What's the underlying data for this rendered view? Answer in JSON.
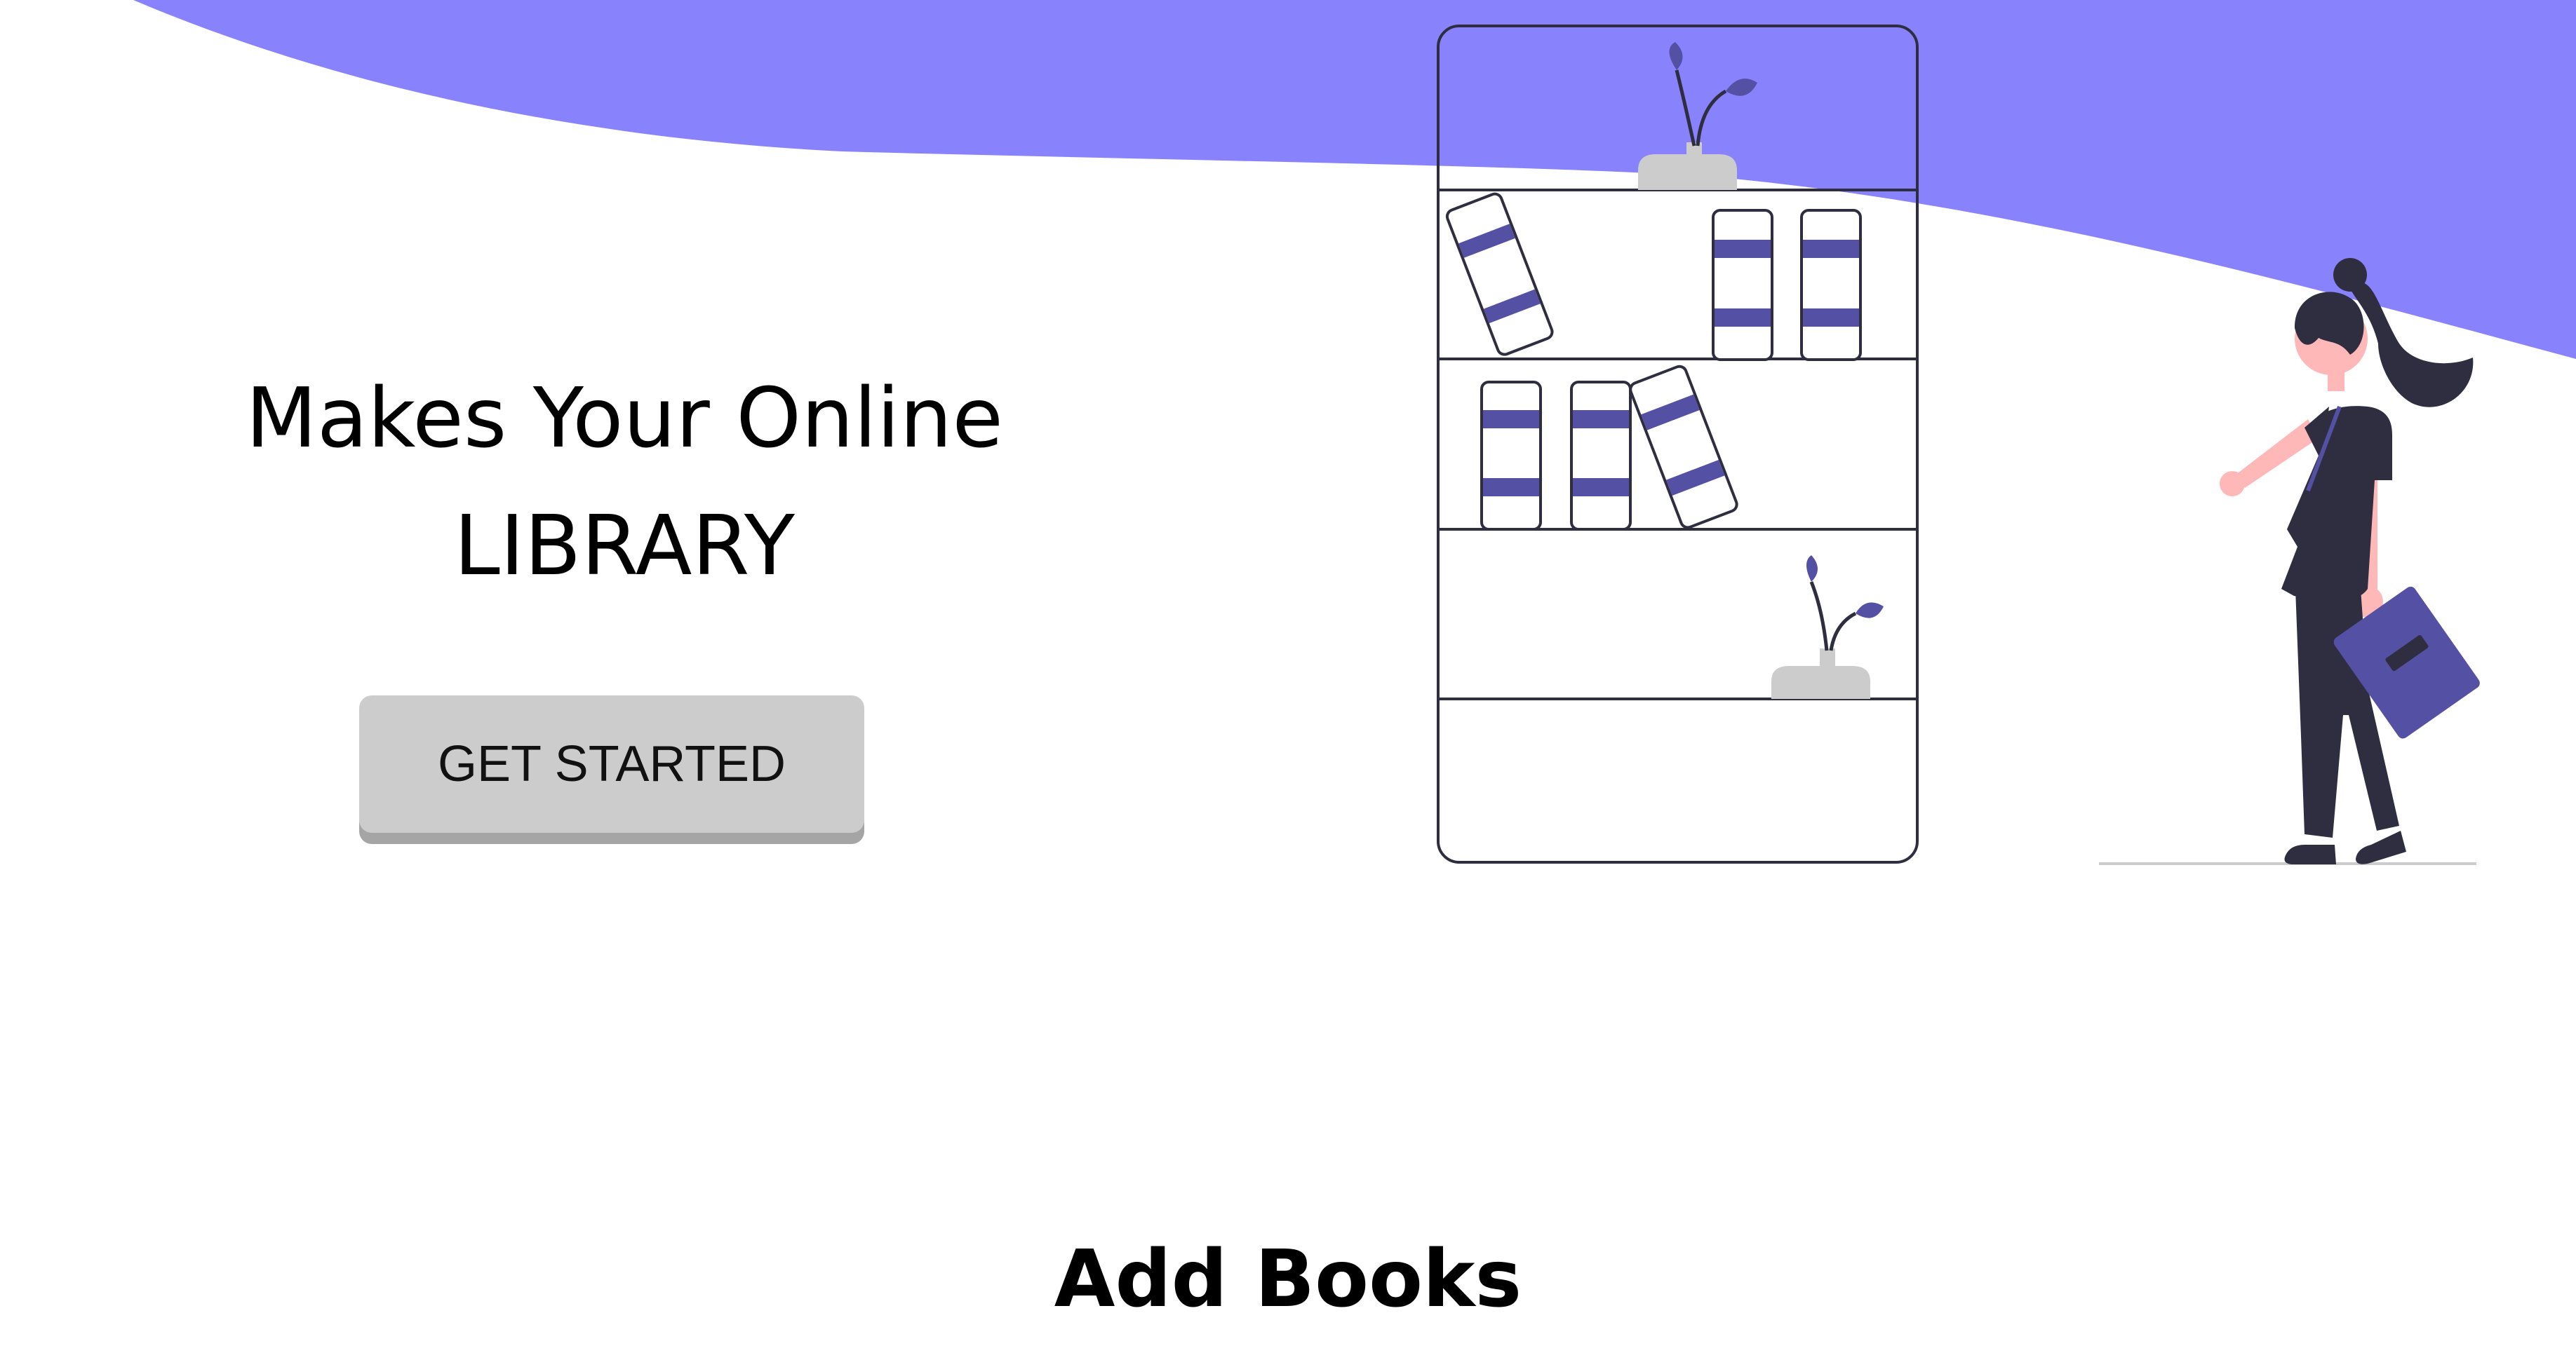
{
  "hero": {
    "title_line1": "Makes Your Online",
    "title_line2": "LIBRARY",
    "cta_label": "GET STARTED"
  },
  "sections": {
    "add_books_title": "Add Books"
  },
  "illustration": {
    "subject": "woman carrying book beside bookshelf"
  },
  "colors": {
    "accent": "#8883fd",
    "book_stripe": "#5450a3",
    "outline": "#2f2e41",
    "skin": "#ffb8b8",
    "button_bg": "#cccccc",
    "button_shadow": "#a5a5a5"
  },
  "icons": {
    "wave": "top-wave-shape",
    "bookshelf": "bookshelf-illustration",
    "person": "woman-with-book-illustration"
  }
}
